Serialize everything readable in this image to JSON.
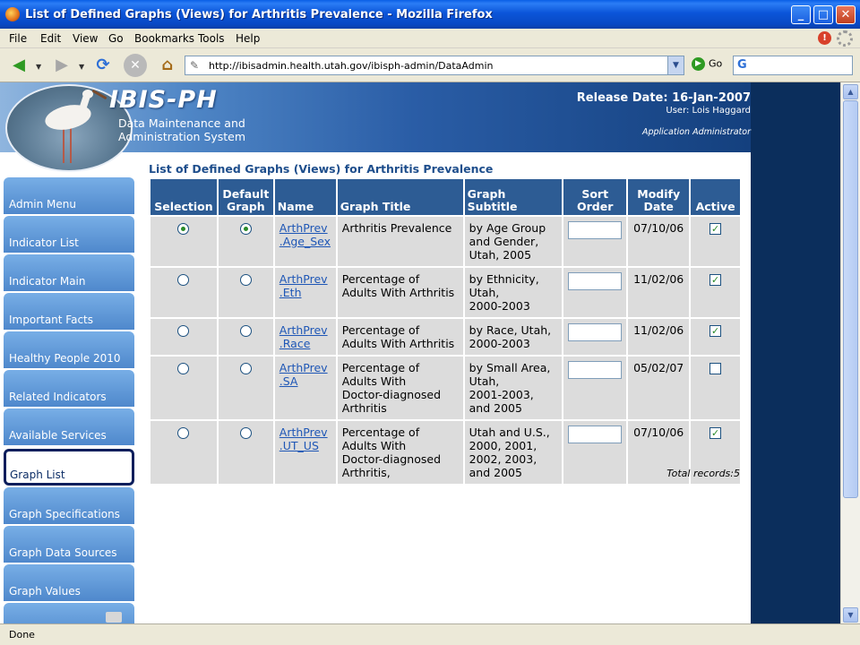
{
  "window": {
    "title": "List of Defined Graphs (Views) for Arthritis Prevalence - Mozilla Firefox",
    "minimize": "_",
    "maximize": "□",
    "close": "✕"
  },
  "menu": [
    "File",
    "Edit",
    "View",
    "Go",
    "Bookmarks",
    "Tools",
    "Help"
  ],
  "nav": {
    "back_icon": "◀",
    "forward_icon": "▶",
    "reload_icon": "⟳",
    "stop_icon": "✕",
    "home_icon": "⌂",
    "url": "http://ibisadmin.health.utah.gov/ibisph-admin/DataAdmin",
    "go_label": "Go",
    "search_value": ""
  },
  "banner": {
    "logo": "IBIS-PH",
    "subtitle_line1": "Data Maintenance and",
    "subtitle_line2": "Administration System",
    "release": "Release Date: 16-Jan-2007",
    "user": "User: Lois Haggard",
    "role": "Application Administrator"
  },
  "sidebar": [
    {
      "label": "Admin Menu",
      "active": false
    },
    {
      "label": "Indicator List",
      "active": false
    },
    {
      "label": "Indicator Main",
      "active": false
    },
    {
      "label": "Important Facts",
      "active": false
    },
    {
      "label": "Healthy People 2010",
      "active": false
    },
    {
      "label": "Related Indicators",
      "active": false
    },
    {
      "label": "Available Services",
      "active": false
    },
    {
      "label": "Graph List",
      "active": true
    },
    {
      "label": "Graph Specifications",
      "active": false
    },
    {
      "label": "Graph Data Sources",
      "active": false
    },
    {
      "label": "Graph Values",
      "active": false
    }
  ],
  "page": {
    "heading": "List of Defined Graphs (Views) for Arthritis Prevalence",
    "total": "Total records:5"
  },
  "table": {
    "headers": {
      "selection": "Selection",
      "default_graph_line1": "Default",
      "default_graph_line2": "Graph",
      "name": "Name",
      "graph_title": "Graph Title",
      "graph_subtitle": "Graph Subtitle",
      "sort_order_line1": "Sort",
      "sort_order_line2": "Order",
      "modify_date_line1": "Modify",
      "modify_date_line2": "Date",
      "active": "Active"
    },
    "rows": [
      {
        "selected": true,
        "default": true,
        "name_line1": "ArthPrev",
        "name_line2": ".Age_Sex",
        "title_lines": [
          "Arthritis Prevalence"
        ],
        "subtitle_lines": [
          "by Age Group",
          "and Gender,",
          "Utah, 2005"
        ],
        "sort_order": "",
        "modify_date": "07/10/06",
        "active": true
      },
      {
        "selected": false,
        "default": false,
        "name_line1": "ArthPrev",
        "name_line2": ".Eth",
        "title_lines": [
          "Percentage of",
          "Adults With Arthritis"
        ],
        "subtitle_lines": [
          "by Ethnicity,",
          "Utah,",
          "2000-2003"
        ],
        "sort_order": "",
        "modify_date": "11/02/06",
        "active": true
      },
      {
        "selected": false,
        "default": false,
        "name_line1": "ArthPrev",
        "name_line2": ".Race",
        "title_lines": [
          "Percentage of",
          "Adults With Arthritis"
        ],
        "subtitle_lines": [
          "by Race, Utah,",
          "2000-2003"
        ],
        "sort_order": "",
        "modify_date": "11/02/06",
        "active": true
      },
      {
        "selected": false,
        "default": false,
        "name_line1": "ArthPrev",
        "name_line2": ".SA",
        "title_lines": [
          "Percentage of",
          "Adults With",
          "Doctor-diagnosed",
          "Arthritis"
        ],
        "subtitle_lines": [
          "by Small Area,",
          "Utah,",
          "2001-2003,",
          "and 2005"
        ],
        "sort_order": "",
        "modify_date": "05/02/07",
        "active": false
      },
      {
        "selected": false,
        "default": false,
        "name_line1": "ArthPrev",
        "name_line2": ".UT_US",
        "title_lines": [
          "Percentage of",
          "Adults With",
          "Doctor-diagnosed",
          "Arthritis,"
        ],
        "subtitle_lines": [
          "Utah and U.S.,",
          "2000, 2001,",
          "2002, 2003,",
          "and 2005"
        ],
        "sort_order": "",
        "modify_date": "07/10/06",
        "active": true
      }
    ]
  },
  "status": "Done",
  "colors": {
    "header_bg": "#2d5c94",
    "cell_bg": "#dcdcdc",
    "link": "#1f57b6",
    "sidebar_tab": "#5b92d3",
    "page_bg": "#0b2e5c"
  }
}
